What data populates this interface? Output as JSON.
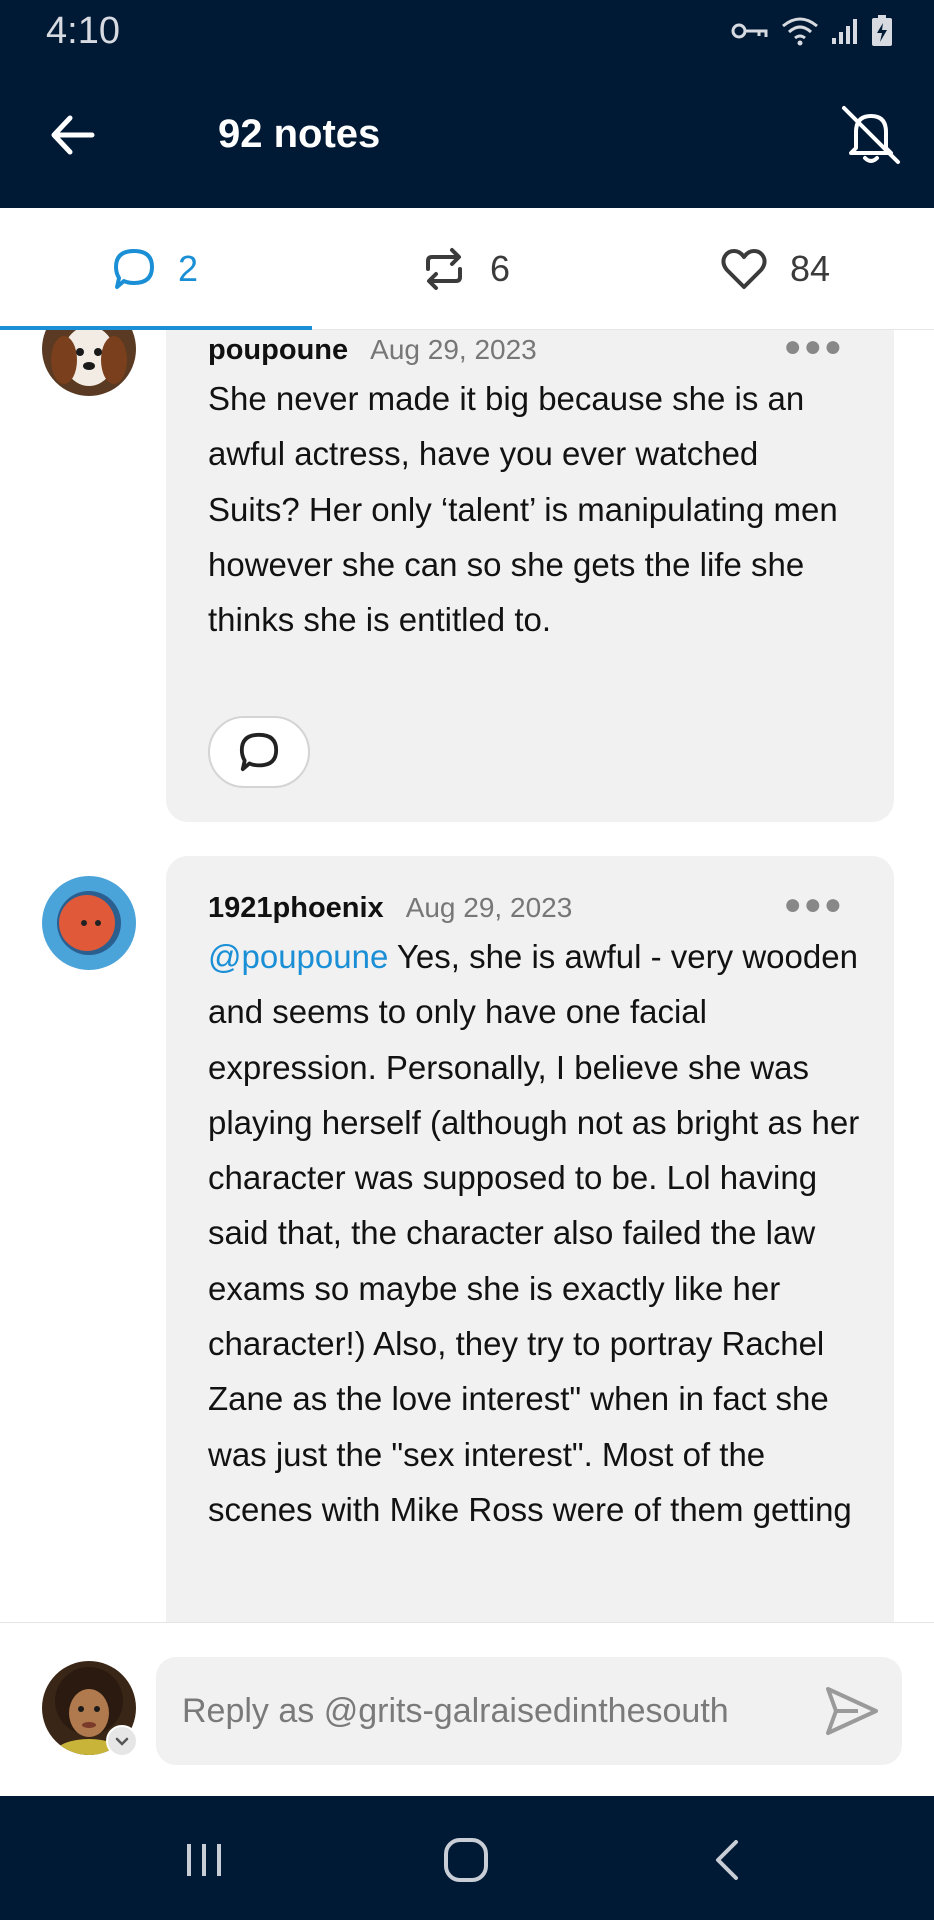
{
  "status_bar": {
    "time": "4:10"
  },
  "header": {
    "title": "92 notes"
  },
  "tabs": [
    {
      "name": "replies",
      "count": "2",
      "active": true
    },
    {
      "name": "reblogs",
      "count": "6",
      "active": false
    },
    {
      "name": "likes",
      "count": "84",
      "active": false
    }
  ],
  "comments": [
    {
      "username": "poupoune",
      "date": "Aug 29, 2023",
      "text": "She never made it big because she is an awful actress, have you ever watched Suits? Her only ‘talent’ is manipulating men however she can so she gets the life she thinks she is entitled to."
    },
    {
      "username": "1921phoenix",
      "date": "Aug 29, 2023",
      "mention": "@poupoune",
      "text": " Yes, she is awful - very wooden and seems to only have one facial expression.  Personally, I believe she was playing herself (although not as bright as her character was supposed to be. Lol having said that, the character also failed the law exams so maybe she is exactly like her character!)  Also, they try to portray Rachel Zane as the love interest\" when in fact she was just the \"sex interest\".  Most of the scenes with Mike Ross were of them getting"
    }
  ],
  "composer": {
    "placeholder": "Reply as @grits-galraisedinthesouth"
  },
  "colors": {
    "navy": "#001935",
    "accent": "#1a8fd6",
    "bubble": "#f1f1f1"
  },
  "icons": {
    "back": "arrow-left-icon",
    "mute": "bell-off-icon",
    "replies": "speech-bubble-icon",
    "reblogs": "reblog-icon",
    "likes": "heart-icon",
    "send": "send-icon"
  }
}
